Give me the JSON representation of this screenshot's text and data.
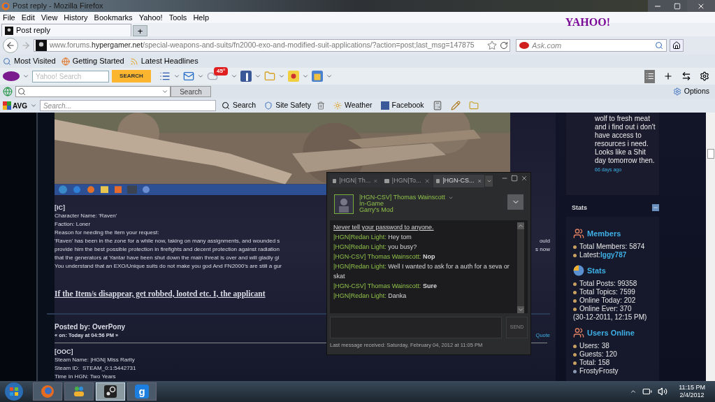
{
  "window": {
    "title": "Post reply - Mozilla Firefox"
  },
  "menu": [
    "File",
    "Edit",
    "View",
    "History",
    "Bookmarks",
    "Yahoo!",
    "Tools",
    "Help"
  ],
  "brand": "YAHOO!",
  "tabs": [
    {
      "label": "Post reply",
      "selected": true
    }
  ],
  "new_tab": "+",
  "address": "www.forums.**hypergamer.net**/special-weapons-and-suits/fn2000-exo-and-modified-suit-applications/?action=post;last_msg=147875",
  "web_search": {
    "placeholder": "Ask.com"
  },
  "bookmarks": [
    "Most Visited",
    "Getting Started",
    "Latest Headlines"
  ],
  "yahoo_toolbar": {
    "placeholder": "Yahoo! Search",
    "button": "SEARCH",
    "badge": "45°"
  },
  "search_toolbar": {
    "button": "Search",
    "options": "Options"
  },
  "avg_toolbar": {
    "brand": "AVG",
    "placeholder": "Search...",
    "items": [
      "Search",
      "Site Safety",
      "Weather",
      "Facebook"
    ]
  },
  "post": {
    "section": "[IC]",
    "lines": [
      {
        "text": "Character Name: 'Raven'"
      },
      {
        "text": "Faction: Loner"
      },
      {
        "text": "Reason for needing the item your request:"
      },
      {
        "text": "'Raven' has been in the zone for a while now, taking on many assignments, and wounded s",
        "tail": "ould"
      },
      {
        "text": "provide him the best possible protection in firefights and decent protection against radiation",
        "tail": "s now"
      },
      {
        "text": "that the generators at Yantar have been shut down the main threat is over and will gladly gi"
      },
      {
        "text": "You understand that an EXO/Unique suits do not make you god And FN2000's are still a gur"
      }
    ],
    "heading": "If the Item/s disappear, get robbed, looted etc. I, the applicant"
  },
  "reply": {
    "author": "Posted by: OverPony",
    "date": "« on: Today at 04:56 PM »",
    "quote": "Quote",
    "section": "[OOC]",
    "lines": [
      "Steam Name: |HGN| Miss Rarity",
      "Steam ID:  STEAM_0:1:5442731",
      "Time In HGN: Two Years"
    ]
  },
  "chat": {
    "tabs": [
      {
        "label": "|HGN| Th...",
        "selected": false
      },
      {
        "label": "|HGN|To...",
        "selected": false
      },
      {
        "label": "|HGN-CS...",
        "selected": true
      }
    ],
    "friend": {
      "name": "|HGN-CSV] Thomas Wainscott",
      "status": "In-Game",
      "game": "Garry's Mod"
    },
    "warning": "Never tell your password to anyone.",
    "messages": [
      {
        "sender": "|HGN|Redan Light:",
        "text": "Hey tom",
        "bold": false
      },
      {
        "sender": "|HGN|Redan Light:",
        "text": "you busy?",
        "bold": false
      },
      {
        "sender": "|HGN-CSV] Thomas Wainscott:",
        "text": "Nop",
        "bold": true
      },
      {
        "sender": "|HGN|Redan Light:",
        "text": "Well I wanted to ask for a auth for a seva or skat",
        "bold": false
      },
      {
        "sender": "|HGN-CSV] Thomas Wainscott:",
        "text": "Sure",
        "bold": true
      },
      {
        "sender": "|HGN|Redan Light:",
        "text": "Danka",
        "bold": false
      }
    ],
    "send": "SEND",
    "footer": "Last message received: Saturday, February 04, 2012 at 11:05 PM"
  },
  "sidebar": {
    "status": "wolf to fresh meat and i find out i don't have access to resources i need. Looks like a Shit day tomorrow then.",
    "status_time": "66 days ago",
    "title": "Stats",
    "sections": [
      {
        "kind": "members",
        "heading": "Members",
        "items": [
          {
            "text": "Total Members: 5874"
          },
          {
            "text": "Latest: ",
            "link": "Iggy787"
          }
        ]
      },
      {
        "kind": "stats",
        "heading": "Stats",
        "items": [
          {
            "text": "Total Posts: 99358"
          },
          {
            "text": "Total Topics: 7599"
          },
          {
            "text": "Online Today: 202"
          },
          {
            "text": "Online Ever: 370"
          }
        ],
        "note": "(30-12-2011, 12:15 PM)"
      },
      {
        "kind": "members",
        "heading": "Users Online",
        "items": [
          {
            "text": "Users: 38"
          },
          {
            "text": "Guests: 120"
          },
          {
            "text": "Total: 158"
          }
        ],
        "users": [
          "FrostyFrosty"
        ]
      }
    ]
  },
  "taskbar": {
    "apps": [
      {
        "kind": "firefox",
        "selected": false
      },
      {
        "kind": "messenger",
        "selected": false
      },
      {
        "kind": "steam",
        "selected": true
      },
      {
        "kind": "gmod",
        "glyph": "g",
        "selected": false
      }
    ],
    "time": "11:15 PM",
    "date": "2/4/2012"
  }
}
